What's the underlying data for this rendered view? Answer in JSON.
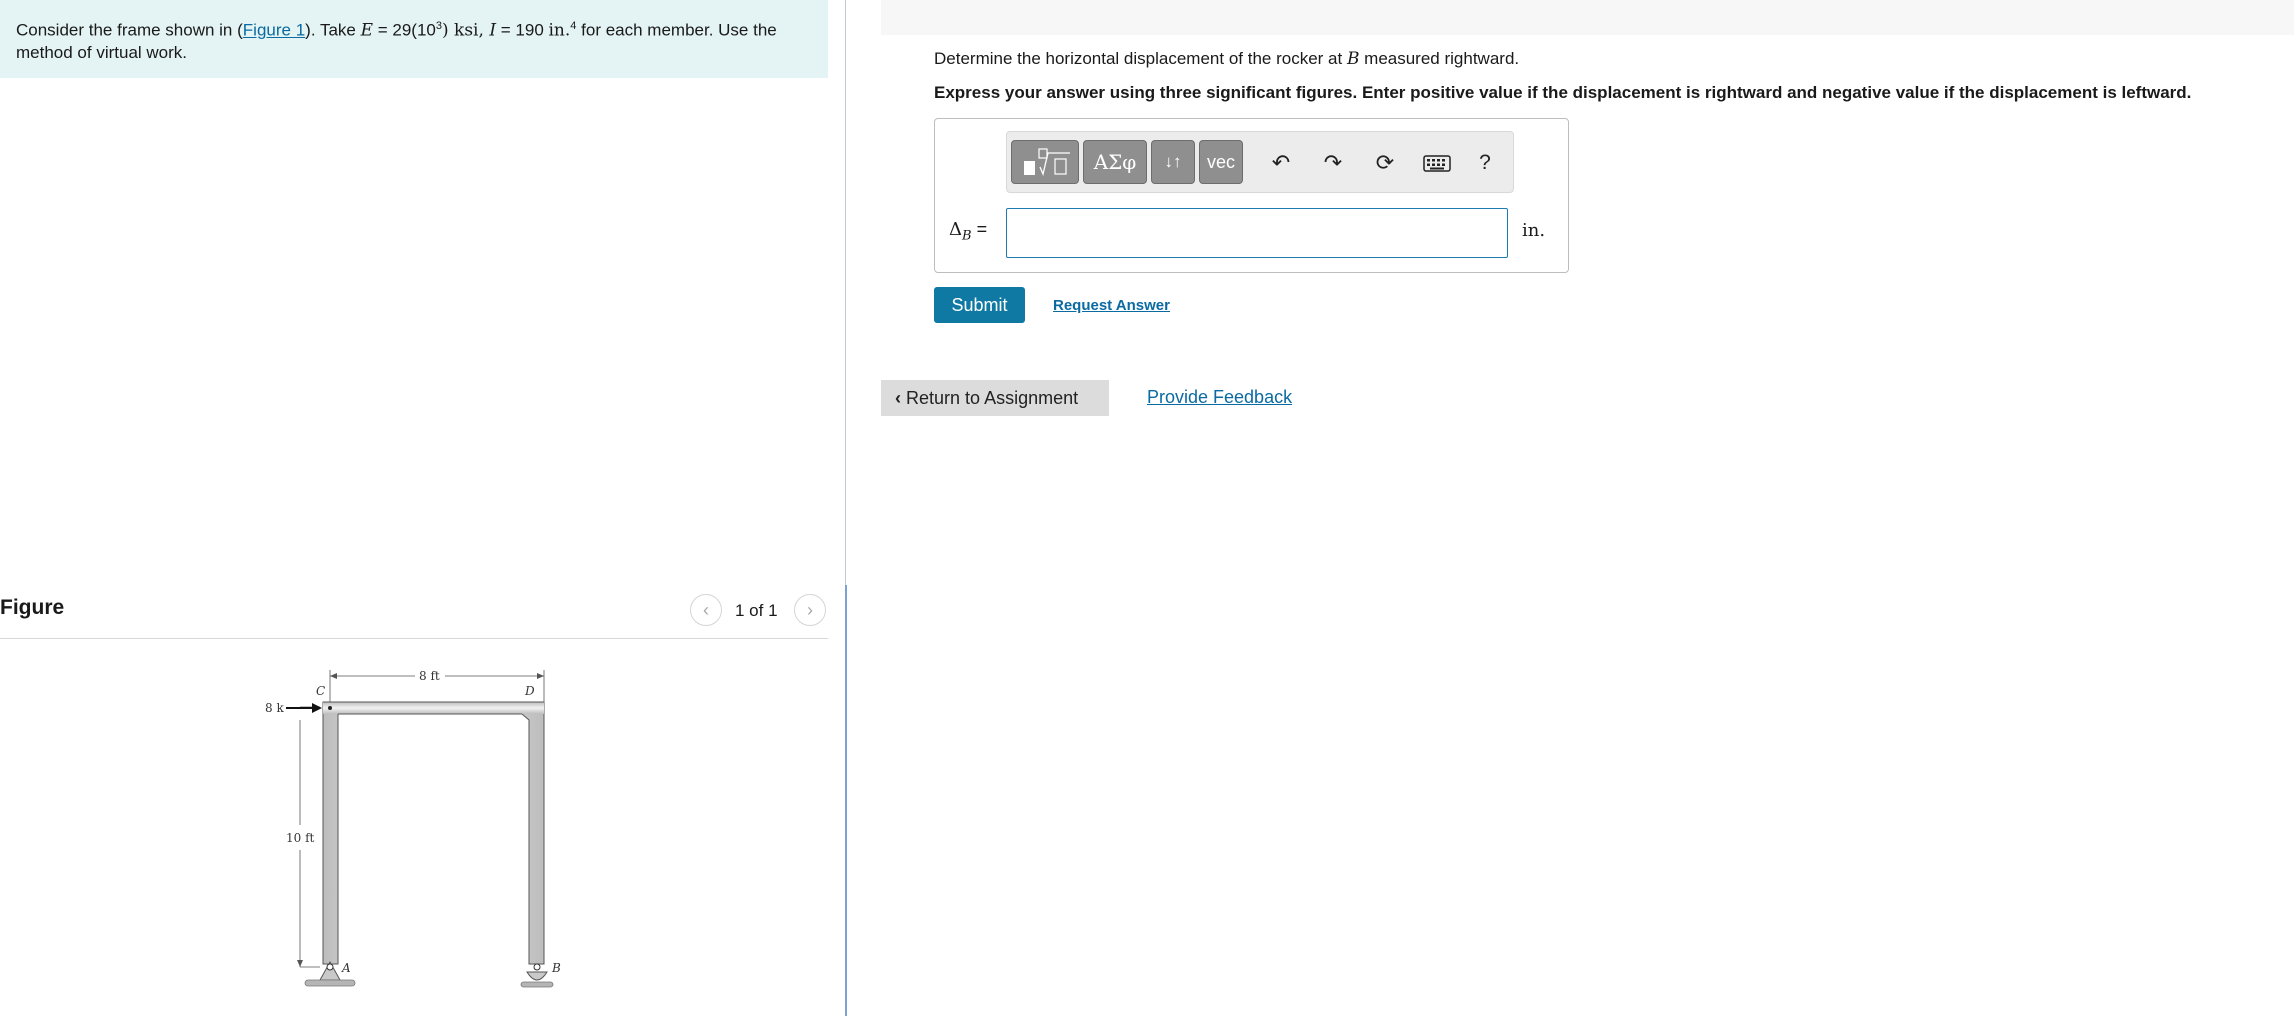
{
  "problem": {
    "text_before": "Consider the frame shown in (",
    "figure_link": "Figure 1",
    "text_take": "). Take ",
    "E_symbol": "E",
    "E_value": " = 29(10",
    "E_exp": "3",
    "E_unit": ") ksi, ",
    "I_symbol": "I",
    "I_value": " = 190 ",
    "I_unit": "in.",
    "I_exp": "4",
    "text_after": " for each member. Use the method of virtual work."
  },
  "figure_panel": {
    "title": "Figure",
    "pager": "1 of 1",
    "prev_icon": "chevron-left-icon",
    "next_icon": "chevron-right-icon",
    "diagram": {
      "load_label": "8 k",
      "span_label": "8 ft",
      "height_label": "10 ft",
      "node_C": "C",
      "node_D": "D",
      "node_A": "A",
      "node_B": "B"
    }
  },
  "question": {
    "text_before": "Determine the horizontal displacement of the rocker at ",
    "B_symbol": "B",
    "text_after": " measured rightward.",
    "instructions": "Express your answer using three significant figures. Enter positive value if the displacement is rightward and negative value if the displacement is leftward."
  },
  "answer": {
    "delta_symbol": "Δ",
    "delta_sub": "B",
    "equals": " =",
    "input_value": "",
    "unit": "in.",
    "toolbar": {
      "templates_icon": "fraction-sqrt-icon",
      "greek_label": "ΑΣφ",
      "arrows_label": "↓↑",
      "vec_label": "vec",
      "undo_icon": "undo-icon",
      "redo_icon": "redo-icon",
      "reset_icon": "reset-icon",
      "keyboard_icon": "keyboard-icon",
      "help_label": "?"
    }
  },
  "actions": {
    "submit": "Submit",
    "request_answer": "Request Answer",
    "return": "Return to Assignment",
    "feedback": "Provide Feedback"
  },
  "colors": {
    "accent": "#0f79a4",
    "link": "#0a6aa1",
    "problem_bg": "#e4f3f3"
  }
}
